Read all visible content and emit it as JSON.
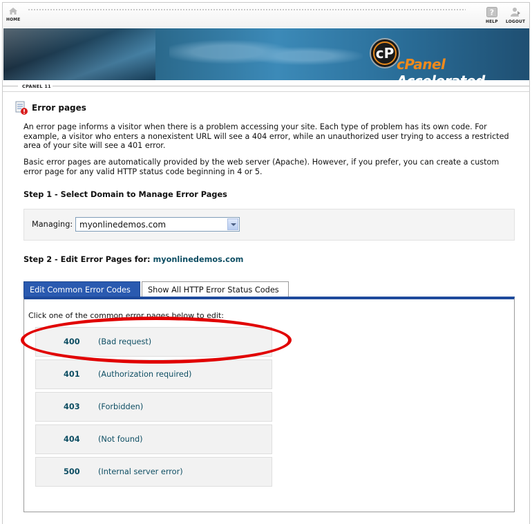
{
  "nav": {
    "home": "HOME",
    "help": "HELP",
    "logout": "LOGOUT"
  },
  "banner": {
    "logo_text": "cP",
    "brand_first": "cPanel",
    "brand_second": "Accelerated"
  },
  "breadcrumb": "CPANEL 11",
  "page": {
    "title": "Error pages",
    "intro": "An error page informs a visitor when there is a problem accessing your site. Each type of problem has its own code. For example, a visitor who enters a nonexistent URL will see a 404 error, while an unauthorized user trying to access a restricted area of your site will see a 401 error.",
    "basic": "Basic error pages are automatically provided by the web server (Apache). However, if you prefer, you can create a custom error page for any valid HTTP status code beginning in 4 or 5."
  },
  "step1": {
    "title": "Step 1 - Select Domain to Manage Error Pages",
    "managing_label": "Managing:",
    "selected_domain": "myonlinedemos.com"
  },
  "step2": {
    "title_prefix": "Step 2 - Edit Error Pages for:",
    "domain": "myonlinedemos.com"
  },
  "tabs": [
    {
      "label": "Edit Common Error Codes",
      "active": true
    },
    {
      "label": "Show All HTTP Error Status Codes",
      "active": false
    }
  ],
  "panel": {
    "hint": "Click one of the common error pages below to edit:",
    "errors": [
      {
        "code": "400",
        "desc": "(Bad request)"
      },
      {
        "code": "401",
        "desc": "(Authorization required)"
      },
      {
        "code": "403",
        "desc": "(Forbidden)"
      },
      {
        "code": "404",
        "desc": "(Not found)"
      },
      {
        "code": "500",
        "desc": "(Internal server error)"
      }
    ]
  },
  "colors": {
    "tab_active": "#2a5ab0",
    "link": "#0e4e63",
    "highlight": "#e10000",
    "brand_accent": "#f08a1c"
  }
}
